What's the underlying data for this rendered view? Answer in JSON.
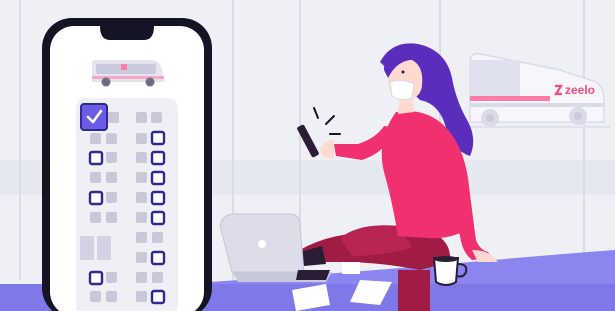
{
  "brand": {
    "logo_text": "zeelo"
  },
  "phone_seat_map": {
    "rows": 9,
    "selected_seat": 1,
    "accent_color": "#6b5ce7",
    "available_color": "#2f2a8f",
    "occupied_color": "#c9c8d8"
  },
  "colors": {
    "background": "#eef0f6",
    "floor": "#8b85f0",
    "shirt": "#f0306f",
    "pants": "#a11c44",
    "hair": "#5a2dbd",
    "phone_frame": "#151425"
  },
  "icons": [
    "checkmark-icon",
    "bus-icon",
    "phone-icon",
    "laptop-icon",
    "mug-icon"
  ]
}
